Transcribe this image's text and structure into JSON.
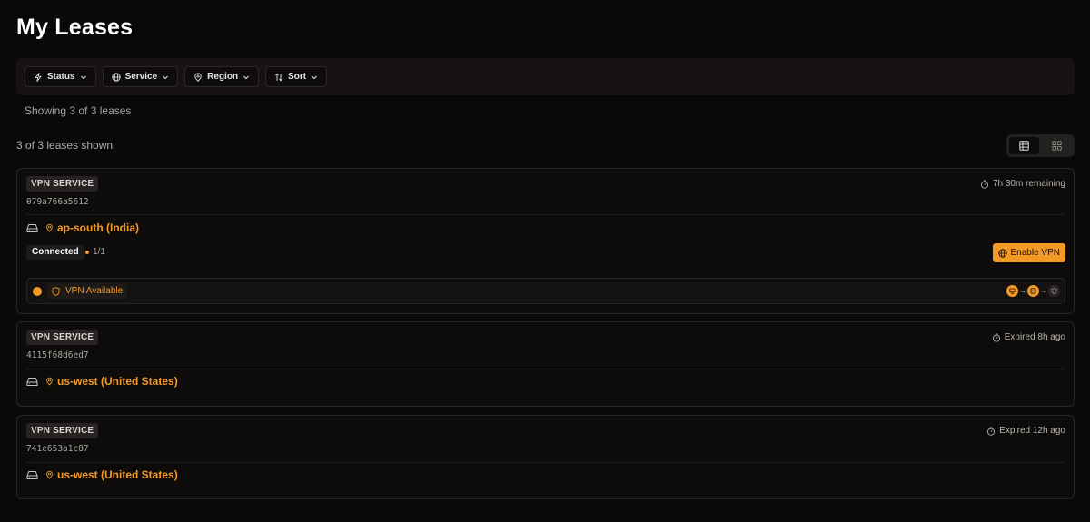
{
  "page": {
    "title": "My Leases"
  },
  "filters": [
    {
      "label": "Status",
      "icon": "bolt-icon"
    },
    {
      "label": "Service",
      "icon": "globe-icon"
    },
    {
      "label": "Region",
      "icon": "map-pin-icon"
    },
    {
      "label": "Sort",
      "icon": "sort-arrows-icon"
    }
  ],
  "summary": {
    "showing": "Showing 3 of 3 leases",
    "shown": "3 of 3 leases shown"
  },
  "view_toggle": {
    "active": "table",
    "options": [
      "table-view-icon",
      "grid-view-icon"
    ]
  },
  "colors": {
    "accent": "#f39a26",
    "background": "#0a0909",
    "card_border": "#2b2726"
  },
  "leases": [
    {
      "service": "VPN SERVICE",
      "id": "079a766a5612",
      "time": "7h 30m remaining",
      "region": "ap-south (India)",
      "status": "Connected",
      "connections": "1/1",
      "action": "Enable VPN",
      "vpn_status": "VPN Available"
    },
    {
      "service": "VPN SERVICE",
      "id": "4115f68d6ed7",
      "time": "Expired 8h ago",
      "region": "us-west (United States)"
    },
    {
      "service": "VPN SERVICE",
      "id": "741e653a1c87",
      "time": "Expired 12h ago",
      "region": "us-west (United States)"
    }
  ]
}
